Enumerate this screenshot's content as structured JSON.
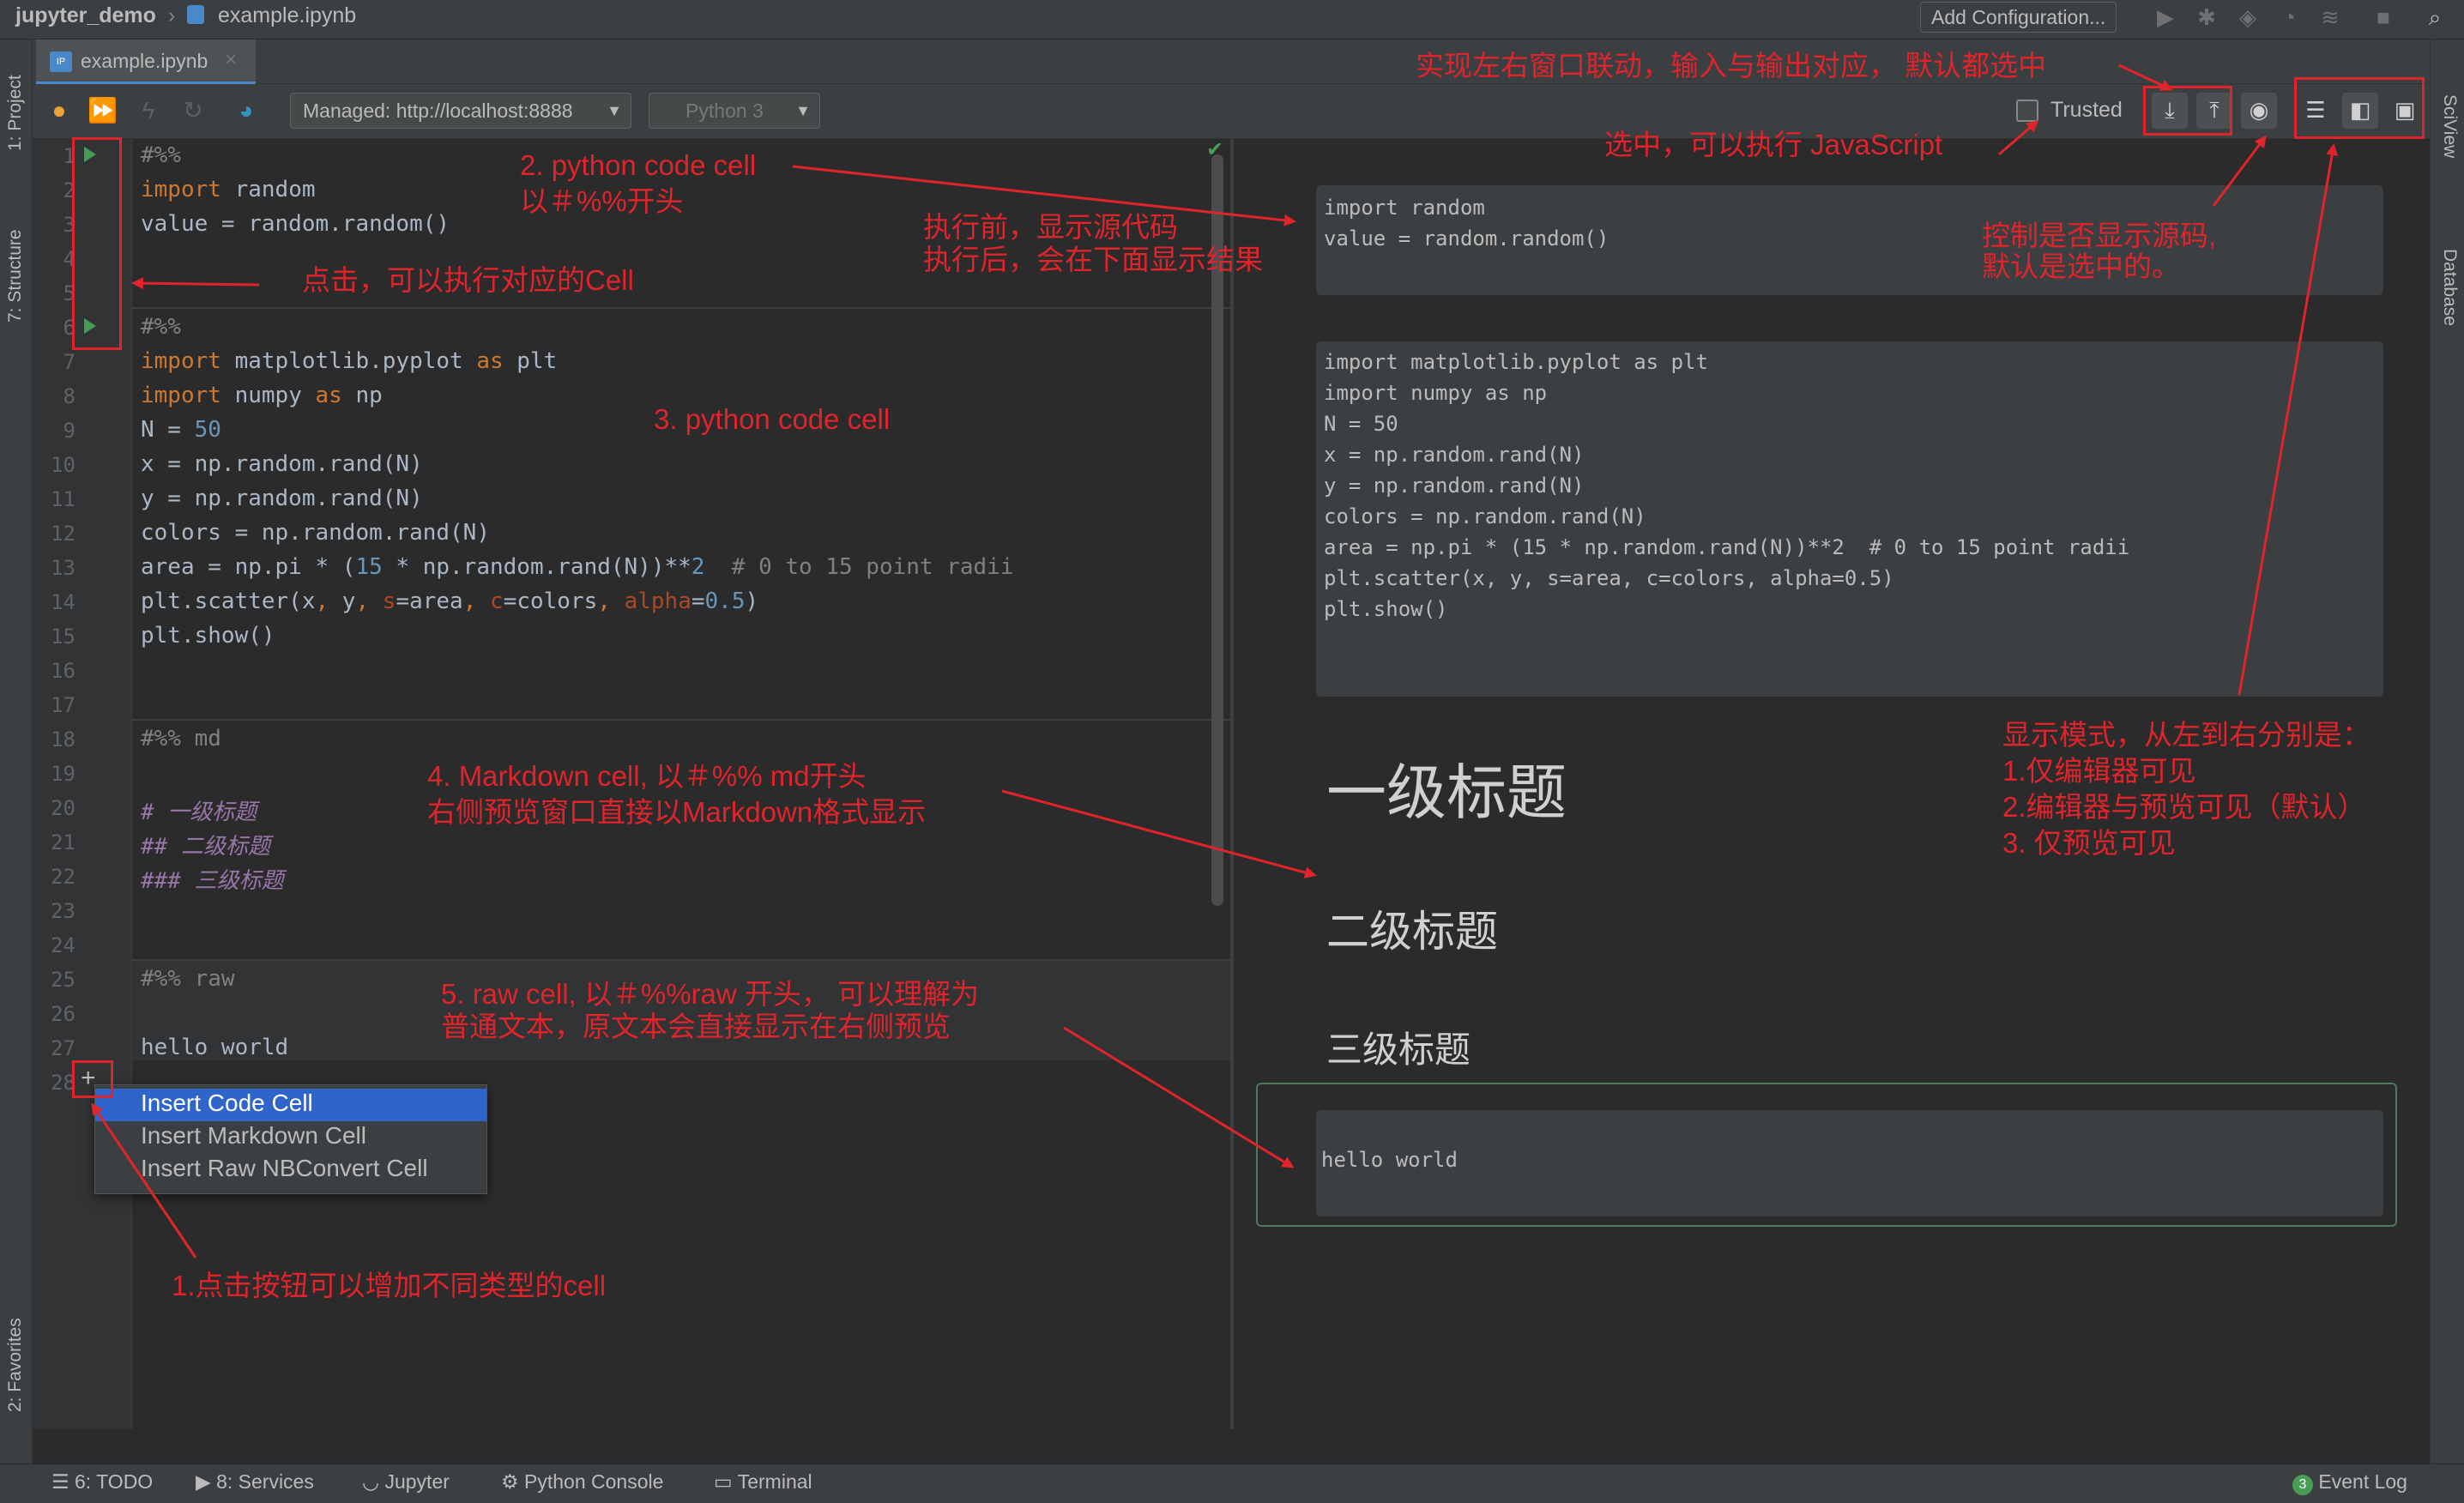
{
  "titlebar": {
    "project": "jupyter_demo",
    "separator": "›",
    "file": "example.ipynb",
    "add_config": "Add Configuration..."
  },
  "left_strip": {
    "project": "1: Project",
    "structure": "7: Structure",
    "favorites": "2: Favorites"
  },
  "right_strip": {
    "sciview": "SciView",
    "database": "Database"
  },
  "tab": {
    "label": "example.ipynb",
    "close": "×",
    "badge": "IP"
  },
  "toolbar": {
    "server": "Managed: http://localhost:8888",
    "kernel": "Python 3",
    "trusted": "Trusted"
  },
  "code_lines": [
    {
      "n": "1",
      "html": "<span class=\"cm\">#%%</span>"
    },
    {
      "n": "2",
      "html": "<span class=\"kw\">import</span> random"
    },
    {
      "n": "3",
      "html": "value = random.random()"
    },
    {
      "n": "4",
      "html": ""
    },
    {
      "n": "5",
      "html": ""
    },
    {
      "n": "6",
      "html": "<span class=\"cm\">#%%</span>"
    },
    {
      "n": "7",
      "html": "<span class=\"kw\">import</span> matplotlib.pyplot <span class=\"kw\">as</span> plt"
    },
    {
      "n": "8",
      "html": "<span class=\"kw\">import</span> numpy <span class=\"kw\">as</span> np"
    },
    {
      "n": "9",
      "html": "N = <span class=\"num\">50</span>"
    },
    {
      "n": "10",
      "html": "x = np.random.rand(N)"
    },
    {
      "n": "11",
      "html": "y = np.random.rand(N)"
    },
    {
      "n": "12",
      "html": "colors = np.random.rand(N)"
    },
    {
      "n": "13",
      "html": "area = np.pi * (<span class=\"num\">15</span> * np.random.rand(N))**<span class=\"num\">2</span>  <span class=\"cm\"># 0 to 15 point radii</span>"
    },
    {
      "n": "14",
      "html": "plt.scatter(x<span class=\"kw\">,</span> y<span class=\"kw\">,</span> <span class=\"prm\">s</span>=area<span class=\"kw\">,</span> <span class=\"prm\">c</span>=colors<span class=\"kw\">,</span> <span class=\"prm\">alpha</span>=<span class=\"num\">0.5</span>)"
    },
    {
      "n": "15",
      "html": "plt.show()"
    },
    {
      "n": "16",
      "html": ""
    },
    {
      "n": "17",
      "html": ""
    },
    {
      "n": "18",
      "html": "<span class=\"cm\">#%% md</span>"
    },
    {
      "n": "19",
      "html": ""
    },
    {
      "n": "20",
      "html": "<span class=\"md\"># 一级标题</span>"
    },
    {
      "n": "21",
      "html": "<span class=\"md\">## 二级标题</span>"
    },
    {
      "n": "22",
      "html": "<span class=\"md\">### 三级标题</span>"
    },
    {
      "n": "23",
      "html": ""
    },
    {
      "n": "24",
      "html": ""
    },
    {
      "n": "25",
      "html": "<span class=\"cm\">#%% raw</span>"
    },
    {
      "n": "26",
      "html": ""
    },
    {
      "n": "27",
      "html": "hello world"
    },
    {
      "n": "28",
      "html": ""
    }
  ],
  "preview": {
    "cell1": [
      "import random",
      "value = random.random()"
    ],
    "cell2": [
      "import matplotlib.pyplot as plt",
      "import numpy as np",
      "N = 50",
      "x = np.random.rand(N)",
      "y = np.random.rand(N)",
      "colors = np.random.rand(N)",
      "area = np.pi * (15 * np.random.rand(N))**2  # 0 to 15 point radii",
      "plt.scatter(x, y, s=area, c=colors, alpha=0.5)",
      "plt.show()"
    ],
    "h1": "一级标题",
    "h2": "二级标题",
    "h3": "三级标题",
    "raw": "hello world"
  },
  "popup": {
    "items": [
      "Insert Code Cell",
      "Insert Markdown Cell",
      "Insert Raw NBConvert Cell"
    ]
  },
  "bottombar": {
    "todo": "6: TODO",
    "services": "8: Services",
    "jupyter": "Jupyter",
    "console": "Python Console",
    "terminal": "Terminal",
    "eventlog": "Event Log",
    "eventcount": "3"
  },
  "annotations": {
    "a1": "1.点击按钮可以增加不同类型的cell",
    "a2_l1": "2. python code cell",
    "a2_l2": "以＃%%开头",
    "a3": "3. python code cell",
    "a4_l1": "4. Markdown cell, 以＃%% md开头",
    "a4_l2": "右侧预览窗口直接以Markdown格式显示",
    "a5_l1": "5. raw cell, 以＃%%raw 开头， 可以理解为",
    "a5_l2": "普通文本，原文本会直接显示在右侧预览",
    "click": "点击，可以执行对应的Cell",
    "exec_l1": "执行前，显示源代码",
    "exec_l2": "执行后，会在下面显示结果",
    "sync": "实现左右窗口联动，输入与输出对应， 默认都选中",
    "js": "选中，可以执行 JavaScript",
    "src_l1": "控制是否显示源码,",
    "src_l2": "默认是选中的。",
    "mode_l1": "显示模式，从左到右分别是：",
    "mode_l2": "1.仅编辑器可见",
    "mode_l3": "2.编辑器与预览可见（默认）",
    "mode_l4": "3. 仅预览可见"
  }
}
